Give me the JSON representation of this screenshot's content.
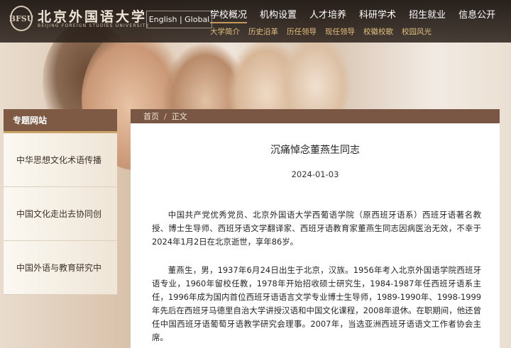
{
  "header": {
    "logo_badge": "BFSU",
    "logo_cn": "北京外国语大学",
    "logo_en": "BEIJING FOREIGN STUDIES UNIVERSITY",
    "lang_switch": "English | Global",
    "nav": [
      "学校概况",
      "机构设置",
      "人才培养",
      "科研学术",
      "招生就业",
      "信息公开"
    ],
    "active_nav": "学校概况",
    "subnav": [
      "大学简介",
      "历史沿革",
      "历任领导",
      "现任领导",
      "校徽校歌",
      "校园风光"
    ]
  },
  "sidebar": {
    "title": "专题网站",
    "items": [
      {
        "label": "中华思想文化术语传播"
      },
      {
        "label": "中国文化走出去协同创"
      },
      {
        "label": "中国外语与教育研究中"
      }
    ]
  },
  "breadcrumb": {
    "home": "首页",
    "separator": "/",
    "current": "正文"
  },
  "article": {
    "title": "沉痛悼念董燕生同志",
    "date": "2024-01-03",
    "paragraphs": [
      "中国共产党优秀党员、北京外国语大学西葡语学院（原西班牙语系）西班牙语著名教授、博士生导师、西班牙语文学翻译家、西班牙语教育家董燕生同志因病医治无效，不幸于2024年1月2日在北京逝世，享年86岁。",
      "董燕生，男，1937年6月24日出生于北京，汉族。1956年考入北京外国语学院西班牙语专业，1960年留校任教，1978年开始招收硕士研究生，1984-1987年任西班牙语系主任，1996年成为国内首位西班牙语语言文学专业博士生导师，1989-1990年、1998-1999年先后在西班牙马德里自治大学讲授汉语和中国文化课程，2008年退休。在职期间，他还曾任中国西班牙语葡萄牙语教学研究会理事。2007年，当选亚洲西班牙语语文工作者协会主席。"
    ]
  },
  "colors": {
    "header_bg": "#2a201a",
    "accent_gold": "#c49a5c",
    "subnav_text": "#e2c07d",
    "sidebar_head_bg": "#7e5a45",
    "breadcrumb_bg": "#7a5744"
  }
}
